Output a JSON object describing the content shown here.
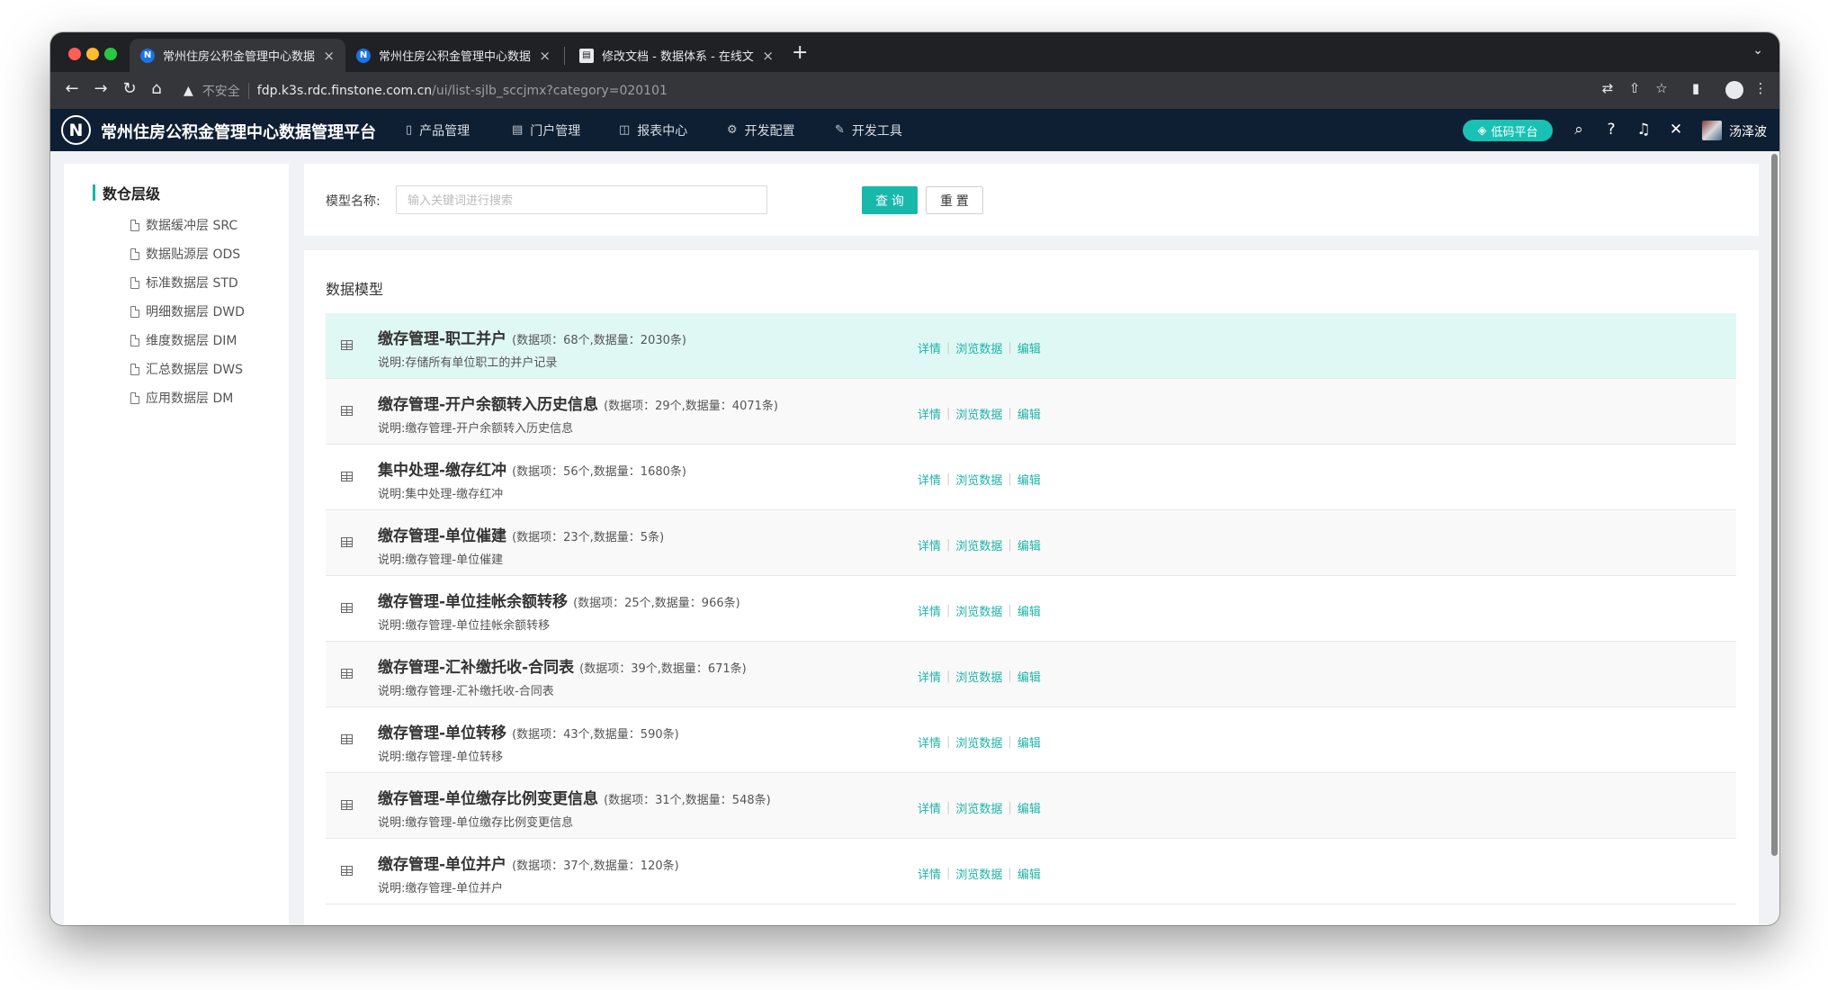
{
  "browser": {
    "tabs": [
      {
        "title": "常州住房公积金管理中心数据管理平台",
        "favicon": "N"
      },
      {
        "title": "常州住房公积金管理中心数据管理平台",
        "favicon": "N"
      },
      {
        "title": "修改文档 - 数据体系 - 在线文档中心",
        "favicon": "doc"
      }
    ],
    "tab_close": "×",
    "new_tab": "+",
    "insecure_label": "不安全",
    "url_host": "fdp.k3s.rdc.finstone.com.cn",
    "url_path": "/ui/list-sjlb_sccjmx?category=020101"
  },
  "header": {
    "logo": "N",
    "title": "常州住房公积金管理中心数据管理平台",
    "menu": [
      {
        "label": "产品管理",
        "icon": "▯"
      },
      {
        "label": "门户管理",
        "icon": "▤"
      },
      {
        "label": "报表中心",
        "icon": "◫"
      },
      {
        "label": "开发配置",
        "icon": "⚙"
      },
      {
        "label": "开发工具",
        "icon": "✎"
      }
    ],
    "lowcode_label": "低码平台",
    "user_name": "汤泽波"
  },
  "sidebar": {
    "title": "数仓层级",
    "items": [
      "数据缓冲层 SRC",
      "数据贴源层 ODS",
      "标准数据层 STD",
      "明细数据层 DWD",
      "维度数据层 DIM",
      "汇总数据层 DWS",
      "应用数据层 DM"
    ]
  },
  "search": {
    "label": "模型名称:",
    "placeholder": "输入关键词进行搜索",
    "query_button": "查 询",
    "reset_button": "重 置"
  },
  "list": {
    "title": "数据模型",
    "actions": {
      "detail": "详情",
      "browse": "浏览数据",
      "edit": "编辑"
    },
    "rows": [
      {
        "name": "缴存管理-职工并户",
        "meta": "(数据项：68个,数据量：2030条)",
        "desc": "说明:存储所有单位职工的并户记录"
      },
      {
        "name": "缴存管理-开户余额转入历史信息",
        "meta": "(数据项：29个,数据量：4071条)",
        "desc": "说明:缴存管理-开户余额转入历史信息"
      },
      {
        "name": "集中处理-缴存红冲",
        "meta": "(数据项：56个,数据量：1680条)",
        "desc": "说明:集中处理-缴存红冲"
      },
      {
        "name": "缴存管理-单位催建",
        "meta": "(数据项：23个,数据量：5条)",
        "desc": "说明:缴存管理-单位催建"
      },
      {
        "name": "缴存管理-单位挂帐余额转移",
        "meta": "(数据项：25个,数据量：966条)",
        "desc": "说明:缴存管理-单位挂帐余额转移"
      },
      {
        "name": "缴存管理-汇补缴托收-合同表",
        "meta": "(数据项：39个,数据量：671条)",
        "desc": "说明:缴存管理-汇补缴托收-合同表"
      },
      {
        "name": "缴存管理-单位转移",
        "meta": "(数据项：43个,数据量：590条)",
        "desc": "说明:缴存管理-单位转移"
      },
      {
        "name": "缴存管理-单位缴存比例变更信息",
        "meta": "(数据项：31个,数据量：548条)",
        "desc": "说明:缴存管理-单位缴存比例变更信息"
      },
      {
        "name": "缴存管理-单位并户",
        "meta": "(数据项：37个,数据量：120条)",
        "desc": "说明:缴存管理-单位并户"
      }
    ]
  },
  "colors": {
    "accent": "#18b8ab",
    "header_bg": "#0f1f33",
    "row_highlight": "#e0f8f4"
  }
}
